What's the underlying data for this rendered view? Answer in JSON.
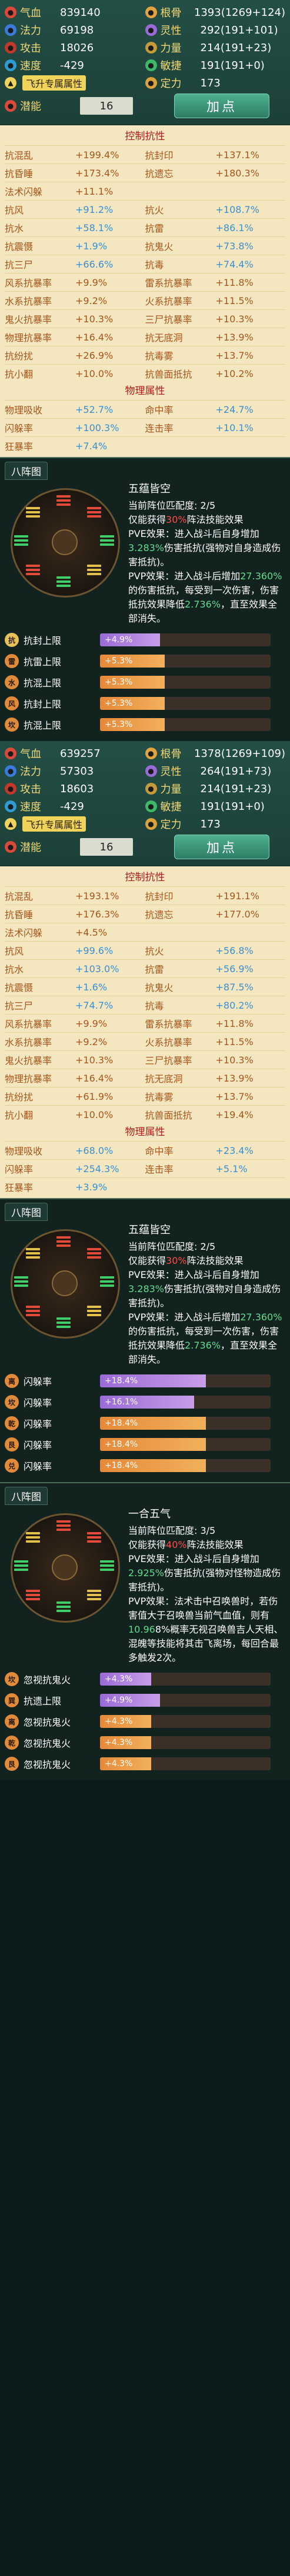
{
  "stats_1": {
    "rows": [
      [
        {
          "icon": "blood-icon",
          "label": "气血",
          "value": "839140",
          "color": "#d94a3a"
        },
        {
          "icon": "bone-icon",
          "label": "根骨",
          "value": "1393(1269+124)",
          "color": "#e0a340"
        }
      ],
      [
        {
          "icon": "mana-icon",
          "label": "法力",
          "value": "69198",
          "color": "#3a7bd9"
        },
        {
          "icon": "spirit-icon",
          "label": "灵性",
          "value": "292(191+101)",
          "color": "#9a6bd6"
        }
      ],
      [
        {
          "icon": "attack-icon",
          "label": "攻击",
          "value": "18026",
          "color": "#c0392b"
        },
        {
          "icon": "strength-icon",
          "label": "力量",
          "value": "214(191+23)",
          "color": "#c49a3a"
        }
      ],
      [
        {
          "icon": "speed-icon",
          "label": "速度",
          "value": "-429",
          "color": "#2f9bd0"
        },
        {
          "icon": "agility-icon",
          "label": "敏捷",
          "value": "191(191+0)",
          "color": "#3fb86a"
        }
      ]
    ],
    "ascend_label": "飞升专属属性",
    "ascend_right_label": "定力",
    "ascend_right_value": "173",
    "potential_label": "潜能",
    "potential_value": "16",
    "add_button": "加点",
    "control_header": "控制抗性",
    "control": [
      [
        "抗混乱",
        "+199.4%"
      ],
      [
        "抗封印",
        "+137.1%"
      ],
      [
        "抗昏睡",
        "+173.4%"
      ],
      [
        "抗遗忘",
        "+180.3%"
      ],
      [
        "法术闪躲",
        "+11.1%"
      ],
      [
        "",
        ""
      ],
      [
        "抗风",
        "+91.2%"
      ],
      [
        "抗火",
        "+108.7%"
      ],
      [
        "抗水",
        "+58.1%"
      ],
      [
        "抗雷",
        "+86.1%"
      ],
      [
        "抗震慑",
        "+1.9%"
      ],
      [
        "抗鬼火",
        "+73.8%"
      ],
      [
        "抗三尸",
        "+66.6%"
      ],
      [
        "抗毒",
        "+74.4%"
      ],
      [
        "风系抗暴率",
        "+9.9%"
      ],
      [
        "雷系抗暴率",
        "+11.8%"
      ],
      [
        "水系抗暴率",
        "+9.2%"
      ],
      [
        "火系抗暴率",
        "+11.5%"
      ],
      [
        "鬼火抗暴率",
        "+10.3%"
      ],
      [
        "三尸抗暴率",
        "+10.3%"
      ],
      [
        "物理抗暴率",
        "+16.4%"
      ],
      [
        "抗无底洞",
        "+13.9%"
      ],
      [
        "抗纷扰",
        "+26.9%"
      ],
      [
        "抗毒雾",
        "+13.7%"
      ],
      [
        "抗小翻",
        "+10.0%"
      ],
      [
        "抗兽面抵抗",
        "+10.2%"
      ]
    ],
    "physical_header": "物理属性",
    "physical": [
      [
        "物理吸收",
        "+52.7%"
      ],
      [
        "命中率",
        "+24.7%"
      ],
      [
        "闪躲率",
        "+100.3%"
      ],
      [
        "连击率",
        "+10.1%"
      ],
      [
        "狂暴率",
        "+7.4%"
      ],
      [
        "",
        ""
      ]
    ]
  },
  "formation_1": {
    "tab": "八阵图",
    "title": "五蕴皆空",
    "line1": "当前阵位匹配度: 2/5",
    "line2_a": "仅能获得",
    "line2_b": "30%",
    "line2_c": "阵法技能效果",
    "pve_a": "PVE效果：进入战斗后自身增加",
    "pve_b": "3.283%",
    "pve_c": "伤害抵抗(强物对自身造成伤害抵抗)。",
    "pvp_a": "PVP效果：进入战斗后增加",
    "pvp_b": "27.360%",
    "pvp_c": "的伤害抵抗，每受到一次伤害，伤害抵抗效果降低",
    "pvp_d": "2.736%",
    "pvp_e": "，直至效果全部消失。",
    "entries": [
      {
        "icon": "抗",
        "label": "抗封上限",
        "value": "+4.9%",
        "fill": 0.35,
        "icolor": "#e5c25a",
        "bar": "purple"
      },
      {
        "icon": "雷",
        "label": "抗雷上限",
        "value": "+5.3%",
        "fill": 0.38,
        "icolor": "#e08a3a",
        "bar": "orange"
      },
      {
        "icon": "水",
        "label": "抗混上限",
        "value": "+5.3%",
        "fill": 0.38,
        "icolor": "#e08a3a",
        "bar": "orange"
      },
      {
        "icon": "风",
        "label": "抗封上限",
        "value": "+5.3%",
        "fill": 0.38,
        "icolor": "#e08a3a",
        "bar": "orange"
      },
      {
        "icon": "坎",
        "label": "抗混上限",
        "value": "+5.3%",
        "fill": 0.38,
        "icolor": "#e08a3a",
        "bar": "orange"
      }
    ]
  },
  "stats_2": {
    "rows": [
      [
        {
          "icon": "blood-icon",
          "label": "气血",
          "value": "639257",
          "color": "#d94a3a"
        },
        {
          "icon": "bone-icon",
          "label": "根骨",
          "value": "1378(1269+109)",
          "color": "#e0a340"
        }
      ],
      [
        {
          "icon": "mana-icon",
          "label": "法力",
          "value": "57303",
          "color": "#3a7bd9"
        },
        {
          "icon": "spirit-icon",
          "label": "灵性",
          "value": "264(191+73)",
          "color": "#9a6bd6"
        }
      ],
      [
        {
          "icon": "attack-icon",
          "label": "攻击",
          "value": "18603",
          "color": "#c0392b"
        },
        {
          "icon": "strength-icon",
          "label": "力量",
          "value": "214(191+23)",
          "color": "#c49a3a"
        }
      ],
      [
        {
          "icon": "speed-icon",
          "label": "速度",
          "value": "-429",
          "color": "#2f9bd0"
        },
        {
          "icon": "agility-icon",
          "label": "敏捷",
          "value": "191(191+0)",
          "color": "#3fb86a"
        }
      ]
    ],
    "ascend_label": "飞升专属属性",
    "ascend_right_label": "定力",
    "ascend_right_value": "173",
    "potential_label": "潜能",
    "potential_value": "16",
    "add_button": "加点",
    "control_header": "控制抗性",
    "control": [
      [
        "抗混乱",
        "+193.1%"
      ],
      [
        "抗封印",
        "+191.1%"
      ],
      [
        "抗昏睡",
        "+176.3%"
      ],
      [
        "抗遗忘",
        "+177.0%"
      ],
      [
        "法术闪躲",
        "+4.5%"
      ],
      [
        "",
        ""
      ],
      [
        "抗风",
        "+99.6%"
      ],
      [
        "抗火",
        "+56.8%"
      ],
      [
        "抗水",
        "+103.0%"
      ],
      [
        "抗雷",
        "+56.9%"
      ],
      [
        "抗震慑",
        "+1.6%"
      ],
      [
        "抗鬼火",
        "+87.5%"
      ],
      [
        "抗三尸",
        "+74.7%"
      ],
      [
        "抗毒",
        "+80.2%"
      ],
      [
        "风系抗暴率",
        "+9.9%"
      ],
      [
        "雷系抗暴率",
        "+11.8%"
      ],
      [
        "水系抗暴率",
        "+9.2%"
      ],
      [
        "火系抗暴率",
        "+11.5%"
      ],
      [
        "鬼火抗暴率",
        "+10.3%"
      ],
      [
        "三尸抗暴率",
        "+10.3%"
      ],
      [
        "物理抗暴率",
        "+16.4%"
      ],
      [
        "抗无底洞",
        "+13.9%"
      ],
      [
        "抗纷扰",
        "+61.9%"
      ],
      [
        "抗毒雾",
        "+13.7%"
      ],
      [
        "抗小翻",
        "+10.0%"
      ],
      [
        "抗兽面抵抗",
        "+19.4%"
      ]
    ],
    "physical_header": "物理属性",
    "physical": [
      [
        "物理吸收",
        "+68.0%"
      ],
      [
        "命中率",
        "+23.4%"
      ],
      [
        "闪躲率",
        "+254.3%"
      ],
      [
        "连击率",
        "+5.1%"
      ],
      [
        "狂暴率",
        "+3.9%"
      ],
      [
        "",
        ""
      ]
    ]
  },
  "formation_2": {
    "tab": "八阵图",
    "title": "五蕴皆空",
    "line1": "当前阵位匹配度: 2/5",
    "line2_a": "仅能获得",
    "line2_b": "30%",
    "line2_c": "阵法技能效果",
    "pve_a": "PVE效果：进入战斗后自身增加",
    "pve_b": "3.283%",
    "pve_c": "伤害抵抗(强物对自身造成伤害抵抗)。",
    "pvp_a": "PVP效果：进入战斗后增加",
    "pvp_b": "27.360%",
    "pvp_c": "的伤害抵抗，每受到一次伤害，伤害抵抗效果降低",
    "pvp_d": "2.736%",
    "pvp_e": "，直至效果全部消失。",
    "entries": [
      {
        "icon": "离",
        "label": "闪躲率",
        "value": "+18.4%",
        "fill": 0.62,
        "icolor": "#e08a3a",
        "bar": "purple"
      },
      {
        "icon": "坎",
        "label": "闪躲率",
        "value": "+16.1%",
        "fill": 0.55,
        "icolor": "#e08a3a",
        "bar": "purple"
      },
      {
        "icon": "乾",
        "label": "闪躲率",
        "value": "+18.4%",
        "fill": 0.62,
        "icolor": "#e08a3a",
        "bar": "orange"
      },
      {
        "icon": "艮",
        "label": "闪躲率",
        "value": "+18.4%",
        "fill": 0.62,
        "icolor": "#e08a3a",
        "bar": "orange"
      },
      {
        "icon": "兑",
        "label": "闪躲率",
        "value": "+18.4%",
        "fill": 0.62,
        "icolor": "#e08a3a",
        "bar": "orange"
      }
    ]
  },
  "formation_3": {
    "tab": "八阵图",
    "title": "一合五气",
    "line1": "当前阵位匹配度: 3/5",
    "line2_a": "仅能获得",
    "line2_b": "40%",
    "line2_c": "阵法技能效果",
    "pve_a": "PVE效果：进入战斗后自身增加",
    "pve_b": "2.925%",
    "pve_c": "伤害抵抗(强物对怪物造成伤害抵抗)。",
    "pvp_a": "PVP效果：法术击中召唤兽时，若伤害值大于召唤兽当前气血值，则有",
    "pvp_b": "10.96",
    "pvp_c": "8%概率无视召唤兽吉人天相、混魄等技能将其击飞离场，每回合最多触发2次。",
    "pvp_d": "",
    "pvp_e": "",
    "entries": [
      {
        "icon": "坎",
        "label": "忽视抗鬼火",
        "value": "+4.3%",
        "fill": 0.3,
        "icolor": "#e08a3a",
        "bar": "purple"
      },
      {
        "icon": "巽",
        "label": "抗遗上限",
        "value": "+4.9%",
        "fill": 0.35,
        "icolor": "#e08a3a",
        "bar": "purple"
      },
      {
        "icon": "离",
        "label": "忽视抗鬼火",
        "value": "+4.3%",
        "fill": 0.3,
        "icolor": "#e08a3a",
        "bar": "orange"
      },
      {
        "icon": "乾",
        "label": "忽视抗鬼火",
        "value": "+4.3%",
        "fill": 0.3,
        "icolor": "#e08a3a",
        "bar": "orange"
      },
      {
        "icon": "艮",
        "label": "忽视抗鬼火",
        "value": "+4.3%",
        "fill": 0.3,
        "icolor": "#e08a3a",
        "bar": "orange"
      }
    ]
  }
}
